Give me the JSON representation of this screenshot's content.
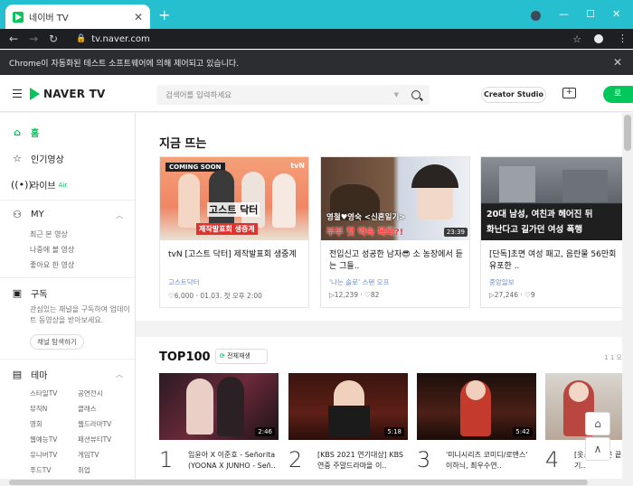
{
  "browser": {
    "tab_title": "네이버 TV",
    "tab_close": "✕",
    "new_tab": "+",
    "minimize": "—",
    "maximize": "☐",
    "close": "✕",
    "url": "tv.naver.com",
    "info_bar": "Chrome이 자동화된 테스트 소프트웨어에 의해 제어되고 있습니다.",
    "info_close": "✕",
    "tab_color": "#25bfcf"
  },
  "header": {
    "logo": "NAVER TV",
    "search_placeholder": "검색어를 입력하세요",
    "creator_studio": "Creator Studio",
    "login": "로",
    "brand_color": "#03c75a"
  },
  "sidebar": {
    "home": "홈",
    "popular": "인기영상",
    "live": "라이브",
    "live_badge": "Air",
    "my": "MY",
    "my_items": [
      "최근 본 영상",
      "나중에 볼 영상",
      "좋아요 한 영상"
    ],
    "subscribe": "구독",
    "subscribe_note": "관심있는 채널을 구독하여 업데이트 동영상을 받아보세요.",
    "channel_find": "채널 탐색하기",
    "theme": "테마",
    "themes": [
      "스타일TV",
      "공연전시",
      "뮤직N",
      "클래스",
      "영화",
      "웹드라마TV",
      "웹예능TV",
      "패션뷰티TV",
      "유니버TV",
      "게임TV",
      "푸드TV",
      "취업"
    ]
  },
  "trending": {
    "title": "지금 뜨는",
    "cards": [
      {
        "title": "tvN [고스트 닥터] 제작발표회 생중계",
        "channel": "고스트닥터",
        "meta": "♡6,000 · 01.03. 첫 오후 2:00",
        "badge": "COMING SOON",
        "caption": "제작발표회 생중계",
        "logo_text": "고스트 닥터",
        "tvn": "tvN"
      },
      {
        "title": "전입신고 성공한 남자😎 소 농장에서 듣는 그들..",
        "channel": "'나는 솔로' 스탠 오프",
        "meta": "▷12,239 · ♡82",
        "duration": "23:39",
        "caption1": "영철♥영숙 <신혼일기>",
        "caption2": "부부 첫 약속 목록?!"
      },
      {
        "title": "[단독]초면 여성 패고, 음란물 56만회 유포한 ..",
        "channel": "중앙일보",
        "meta": "▷27,246 · ♡9",
        "caption1": "20대 남성, 여친과 헤어진 뒤",
        "caption2": "화난다고 길가던 여성 폭행"
      }
    ]
  },
  "top100": {
    "title": "TOP100",
    "filter": "전체재생",
    "pager": "1 1 오",
    "items": [
      {
        "rank": "1",
        "title": "임윤아 X 이준호 - Señorita (YOONA X JUNHO - Señ..",
        "duration": "2:46"
      },
      {
        "rank": "2",
        "title": "[KBS 2021 연기대상] KBS 연중 주말드라마을 이..",
        "duration": "5:18"
      },
      {
        "rank": "3",
        "title": "'미니시리즈 코미디/로맨스' 이하늬, 최우수연..",
        "duration": "5:42"
      },
      {
        "rank": "4",
        "title": "[옷소매 붉은 끝동] ..하 공기..",
        "duration": ""
      }
    ]
  },
  "floating": {
    "home_icon": "⌂",
    "up_icon": "∧"
  }
}
